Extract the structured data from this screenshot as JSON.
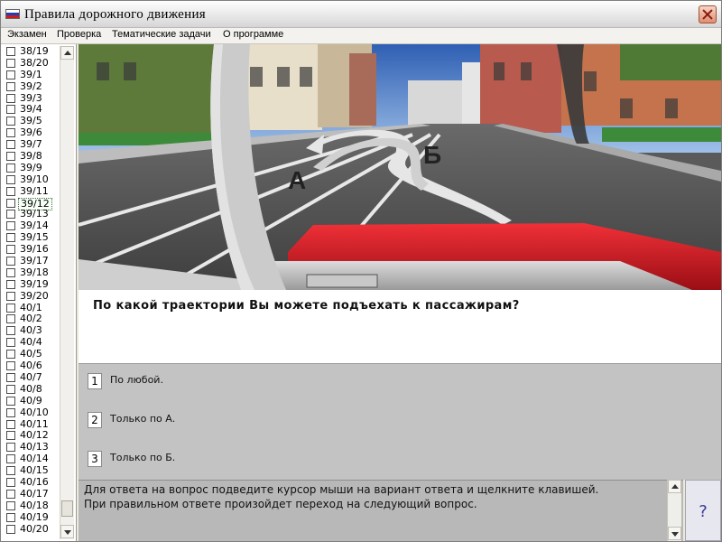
{
  "window": {
    "title": "Правила дорожного движения"
  },
  "menu": {
    "items": [
      "Экзамен",
      "Проверка",
      "Тематические задачи",
      "О программе"
    ]
  },
  "sidebar": {
    "selected": "39/12",
    "items": [
      "38/19",
      "38/20",
      "39/1",
      "39/2",
      "39/3",
      "39/4",
      "39/5",
      "39/6",
      "39/7",
      "39/8",
      "39/9",
      "39/10",
      "39/11",
      "39/12",
      "39/13",
      "39/14",
      "39/15",
      "39/16",
      "39/17",
      "39/18",
      "39/19",
      "39/20",
      "40/1",
      "40/2",
      "40/3",
      "40/4",
      "40/5",
      "40/6",
      "40/7",
      "40/8",
      "40/9",
      "40/10",
      "40/11",
      "40/12",
      "40/13",
      "40/14",
      "40/15",
      "40/16",
      "40/17",
      "40/18",
      "40/19",
      "40/20"
    ]
  },
  "scene": {
    "label_a": "А",
    "label_b": "Б"
  },
  "question": {
    "text": "По какой траектории Вы можете подъехать к пассажирам?"
  },
  "answers": [
    {
      "num": "1",
      "text": "По любой."
    },
    {
      "num": "2",
      "text": "Только по А."
    },
    {
      "num": "3",
      "text": "Только по Б."
    }
  ],
  "hint": {
    "line1": "Для ответа на вопрос подведите курсор мыши на вариант ответа и щелкните клавишей.",
    "line2": "При правильном ответе произойдет переход на следующий вопрос."
  },
  "help": {
    "label": "?"
  },
  "colors": {
    "flag_white": "#ffffff",
    "flag_blue": "#1f3fb5",
    "flag_red": "#d11a1a",
    "car_red": "#d8141e",
    "sky": "#2f5fb3"
  }
}
